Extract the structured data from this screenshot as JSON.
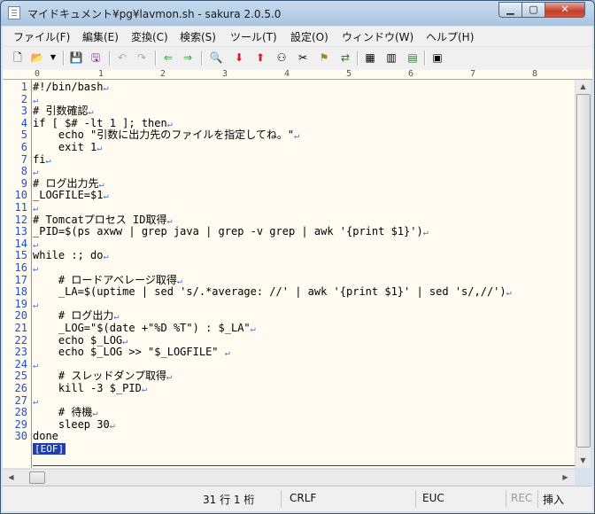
{
  "window": {
    "title": "マイドキュメント¥pg¥lavmon.sh - sakura 2.0.5.0"
  },
  "menu": [
    {
      "label": "ファイル(F)"
    },
    {
      "label": "編集(E)"
    },
    {
      "label": "変換(C)"
    },
    {
      "label": "検索(S)"
    },
    {
      "label": "ツール(T)"
    },
    {
      "label": "設定(O)"
    },
    {
      "label": "ウィンドウ(W)"
    },
    {
      "label": "ヘルプ(H)"
    }
  ],
  "toolbar": {
    "icons": [
      "new-file-icon",
      "open-folder-icon",
      "dropdown-icon",
      "save-icon",
      "save-all-icon",
      "undo-icon",
      "redo-icon",
      "back-icon",
      "forward-icon",
      "search-icon",
      "search-next-icon",
      "search-prev-icon",
      "grep-icon",
      "find-clear-icon",
      "bookmark-icon",
      "replace-icon",
      "outline-icon",
      "settings-icon",
      "typeset-icon",
      "window-list-icon"
    ]
  },
  "ruler": [
    "0",
    "1",
    "2",
    "3",
    "4",
    "5",
    "6",
    "7",
    "8"
  ],
  "editor": {
    "lines": [
      {
        "num": "1",
        "text": "#!/bin/bash"
      },
      {
        "num": "2",
        "text": ""
      },
      {
        "num": "3",
        "text": "# 引数確認"
      },
      {
        "num": "4",
        "text": "if [ $# -lt 1 ]; then"
      },
      {
        "num": "5",
        "text": "    echo \"引数に出力先のファイルを指定してね。\""
      },
      {
        "num": "6",
        "text": "    exit 1"
      },
      {
        "num": "7",
        "text": "fi"
      },
      {
        "num": "8",
        "text": ""
      },
      {
        "num": "9",
        "text": "# ログ出力先"
      },
      {
        "num": "10",
        "text": "_LOGFILE=$1"
      },
      {
        "num": "11",
        "text": ""
      },
      {
        "num": "12",
        "text": "# Tomcatプロセス ID取得"
      },
      {
        "num": "13",
        "text": "_PID=$(ps axww | grep java | grep -v grep | awk '{print $1}')"
      },
      {
        "num": "14",
        "text": ""
      },
      {
        "num": "15",
        "text": "while :; do"
      },
      {
        "num": "16",
        "text": ""
      },
      {
        "num": "17",
        "text": "    # ロードアベレージ取得"
      },
      {
        "num": "18",
        "text": "    _LA=$(uptime | sed 's/.*average: //' | awk '{print $1}' | sed 's/,//')"
      },
      {
        "num": "19",
        "text": ""
      },
      {
        "num": "20",
        "text": "    # ログ出力"
      },
      {
        "num": "21",
        "text": "    _LOG=\"$(date +\"%D %T\") : $_LA\""
      },
      {
        "num": "22",
        "text": "    echo $_LOG"
      },
      {
        "num": "23",
        "text": "    echo $_LOG >> \"$_LOGFILE\" "
      },
      {
        "num": "24",
        "text": ""
      },
      {
        "num": "25",
        "text": "    # スレッドダンプ取得"
      },
      {
        "num": "26",
        "text": "    kill -3 $_PID"
      },
      {
        "num": "27",
        "text": ""
      },
      {
        "num": "28",
        "text": "    # 待機"
      },
      {
        "num": "29",
        "text": "    sleep 30"
      },
      {
        "num": "30",
        "text": "done"
      }
    ],
    "crlf_mark": "↵",
    "eof_marker": "[EOF]"
  },
  "status": {
    "position": "31 行  1 桁",
    "line_ending": "CRLF",
    "encoding": "EUC",
    "rec": "REC",
    "mode": "挿入"
  },
  "colors": {
    "line_number": "#1f4fd6",
    "crlf": "#3b6fd6",
    "eof_bg": "#1f3fae",
    "editor_bg": "#fffbf0"
  }
}
